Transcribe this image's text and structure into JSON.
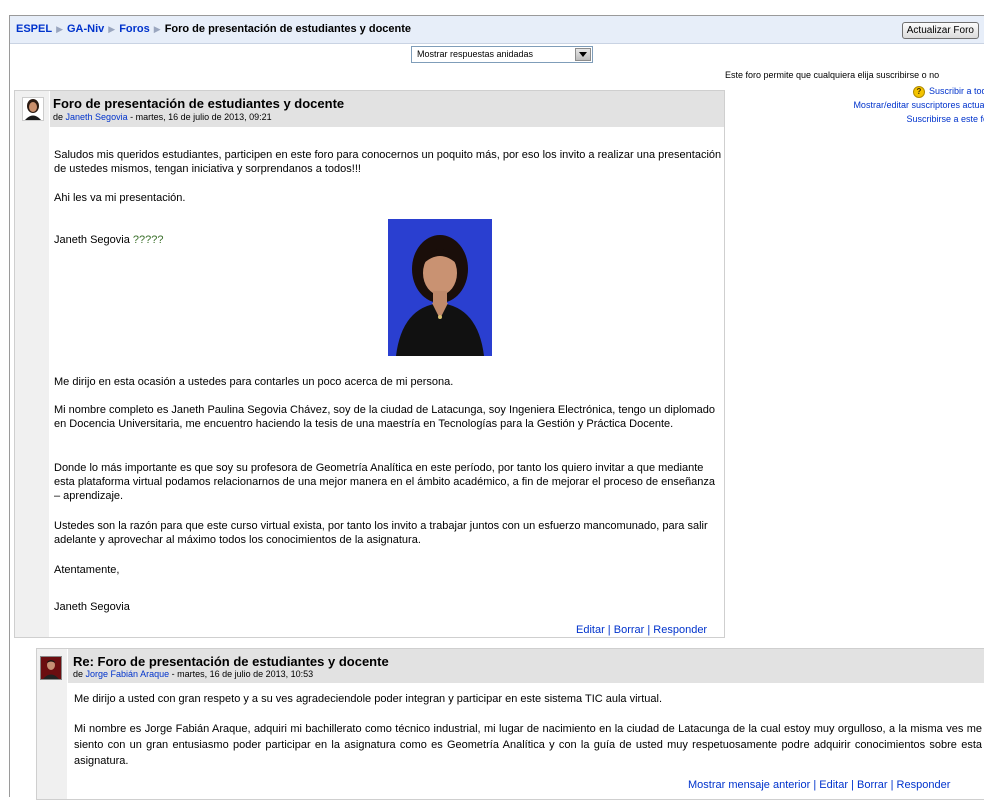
{
  "nav": {
    "crumbs": [
      "ESPEL",
      "GA-Niv",
      "Foros"
    ],
    "current": "Foro de presentación de estudiantes y docente",
    "update_button": "Actualizar Foro"
  },
  "display_mode": {
    "selected": "Mostrar respuestas anidadas"
  },
  "subscription": {
    "info": "Este foro permite que cualquiera elija suscribirse o no",
    "subscribe_all": "Suscribir a todos",
    "show_subscribers": "Mostrar/editar suscriptores actuales",
    "subscribe_forum": "Suscribirse a este foro"
  },
  "post1": {
    "title": "Foro de presentación de estudiantes y docente",
    "by_prefix": "de",
    "author": "Janeth Segovia",
    "date": " - martes, 16 de julio de 2013, 09:21",
    "paragraphs": [
      "Saludos mis queridos estudiantes, participen en este foro para conocernos un poquito más, por eso los invito a realizar una presentación de ustedes mismos, tengan iniciativa y sorprendanos a todos!!!",
      "Ahi les va mi presentación.",
      "Janeth Segovia",
      "?????",
      "Me dirijo en esta ocasión a ustedes para contarles un poco acerca de mi persona.",
      "Mi nombre completo es Janeth Paulina Segovia Chávez, soy de la ciudad de Latacunga, soy Ingeniera Electrónica, tengo un diplomado en Docencia Universitaria, me encuentro haciendo la tesis de una maestría en Tecnologías para la Gestión y Práctica Docente.",
      "Donde lo más importante es que soy su profesora de Geometría Analítica en este período, por tanto los quiero invitar a que mediante esta plataforma virtual podamos relacionarnos de una mejor manera en el ámbito académico, a fin de mejorar el proceso de enseñanza – aprendizaje.",
      "Ustedes son la razón para que este curso virtual exista, por tanto los invito a trabajar juntos con un esfuerzo mancomunado, para salir adelante y aprovechar al máximo todos los conocimientos de la asignatura.",
      "Atentamente,",
      "Janeth Segovia"
    ],
    "actions": [
      "Editar",
      "Borrar",
      "Responder"
    ]
  },
  "post2": {
    "title": "Re: Foro de presentación de estudiantes y docente",
    "by_prefix": "de",
    "author": "Jorge Fabián Araque",
    "date": " - martes, 16 de julio de 2013, 10:53",
    "paragraphs": [
      "Me dirijo a usted con gran respeto y a su ves agradeciendole poder integran y participar en este sistema TIC aula virtual.",
      "Mi nombre es Jorge Fabián Araque, adquiri mi bachillerato como técnico industrial, mi lugar de nacimiento en la ciudad de Latacunga de la cual estoy muy orgulloso, a la misma ves me siento con un gran entusiasmo poder participar en la asignatura como es Geometría Analítica y con la guía de usted muy respetuosamente podre adquirir conocimientos sobre esta asignatura."
    ],
    "actions": [
      "Mostrar mensaje anterior",
      "Editar",
      "Borrar",
      "Responder"
    ]
  },
  "colors": {
    "link": "#0033cc",
    "header_gray": "#e2e2e2",
    "nav_bg": "#e7eef9",
    "question_green": "#3a6f2a"
  }
}
